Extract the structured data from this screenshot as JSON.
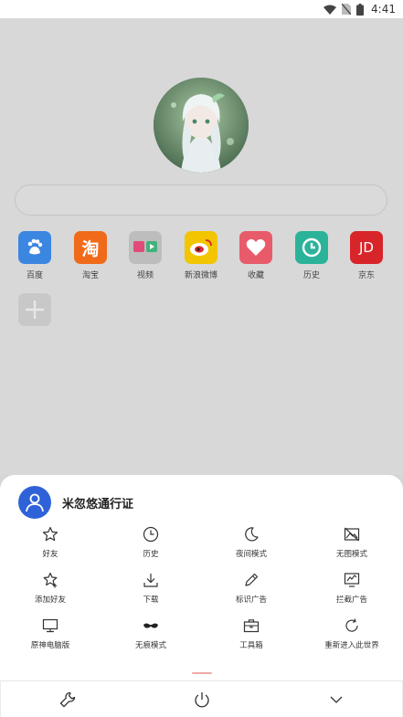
{
  "status_bar": {
    "time": "4:41"
  },
  "shortcuts": [
    {
      "label": "百度",
      "icon": "baidu-paw-icon",
      "color": "#3b86e0"
    },
    {
      "label": "淘宝",
      "icon": "taobao-icon",
      "glyph": "淘",
      "color": "#f06a1a"
    },
    {
      "label": "视频",
      "icon": "video-folder-icon",
      "color": "#bdbdbd"
    },
    {
      "label": "新浪微博",
      "icon": "weibo-icon",
      "color": "#f2c500"
    },
    {
      "label": "收藏",
      "icon": "heart-icon",
      "color": "#e85b6a"
    },
    {
      "label": "历史",
      "icon": "clock-icon",
      "color": "#2bb39a"
    },
    {
      "label": "京东",
      "icon": "jd-icon",
      "glyph": "JD",
      "color": "#d8252a"
    }
  ],
  "menu": {
    "user_name": "米忽悠通行证",
    "items": [
      {
        "label": "好友",
        "icon": "star-icon"
      },
      {
        "label": "历史",
        "icon": "clock-icon"
      },
      {
        "label": "夜间模式",
        "icon": "moon-icon"
      },
      {
        "label": "无图模式",
        "icon": "no-image-icon"
      },
      {
        "label": "添加好友",
        "icon": "star-plus-icon"
      },
      {
        "label": "下载",
        "icon": "download-icon"
      },
      {
        "label": "标识广告",
        "icon": "pen-icon"
      },
      {
        "label": "拦截广告",
        "icon": "ad-block-icon"
      },
      {
        "label": "原神电脑版",
        "icon": "monitor-icon"
      },
      {
        "label": "无痕模式",
        "icon": "incognito-mask-icon"
      },
      {
        "label": "工具箱",
        "icon": "toolbox-icon"
      },
      {
        "label": "重新进入此世界",
        "icon": "refresh-icon"
      }
    ]
  },
  "bottom_bar": [
    {
      "icon": "wrench-icon"
    },
    {
      "icon": "power-icon"
    },
    {
      "icon": "chevron-down-icon"
    }
  ]
}
